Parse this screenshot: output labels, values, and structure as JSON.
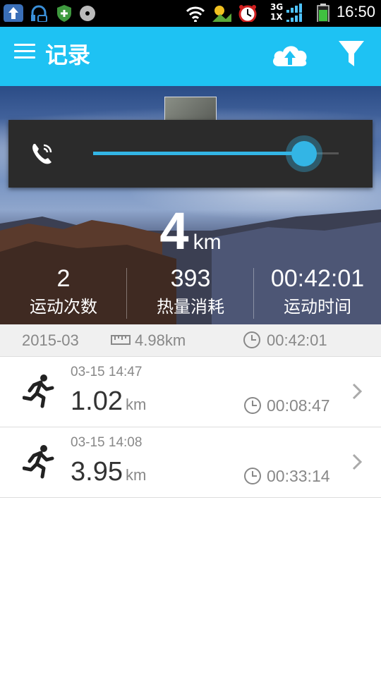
{
  "status_bar": {
    "time": "16:50",
    "network_top": "3G",
    "network_bottom": "1X"
  },
  "app_bar": {
    "title": "记录",
    "icons": [
      "menu-icon",
      "cloud-upload-icon",
      "filter-icon"
    ],
    "color": "#1ec2f3"
  },
  "hero": {
    "distance_value": "4",
    "distance_unit": "km",
    "stats": [
      {
        "value": "2",
        "label": "运动次数"
      },
      {
        "value": "393",
        "label": "热量消耗"
      },
      {
        "value": "00:42:01",
        "label": "运动时间"
      }
    ]
  },
  "volume_overlay": {
    "icon": "phone-call-icon",
    "level": 0.86,
    "accent": "#33b5e5"
  },
  "summary": {
    "month": "2015-03",
    "distance": "4.98km",
    "duration": "00:42:01"
  },
  "records": [
    {
      "datetime": "03-15 14:47",
      "distance": "1.02",
      "unit": "km",
      "duration": "00:08:47"
    },
    {
      "datetime": "03-15 14:08",
      "distance": "3.95",
      "unit": "km",
      "duration": "00:33:14"
    }
  ]
}
